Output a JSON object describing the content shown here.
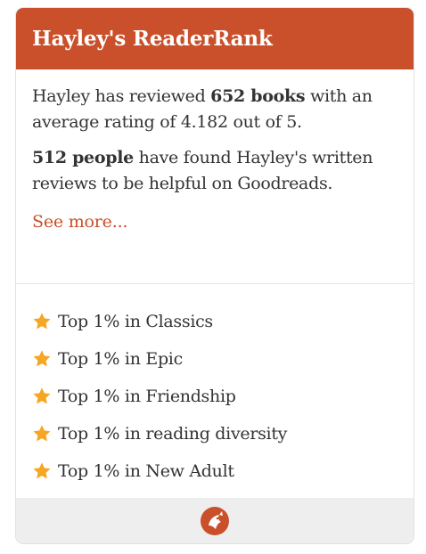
{
  "widget": {
    "title": "Hayley's ReaderRank"
  },
  "stats": {
    "p1_pre": "Hayley has reviewed ",
    "p1_bold": "652 books",
    "p1_post": " with an average rating of 4.182 out of 5.",
    "p2_bold": "512 people",
    "p2_post": " have found Hayley's written reviews to be helpful on Goodreads.",
    "see_more": "See more..."
  },
  "ranks": [
    "Top 1% in Classics",
    "Top 1% in Epic",
    "Top 1% in Friendship",
    "Top 1% in reading diversity",
    "Top 1% in New Adult"
  ],
  "colors": {
    "accent": "#c9502b",
    "star": "#f5a623",
    "footer_bg": "#eeeeee"
  },
  "icons": {
    "rank": "star-icon",
    "footer": "goodreads-logo-icon"
  }
}
